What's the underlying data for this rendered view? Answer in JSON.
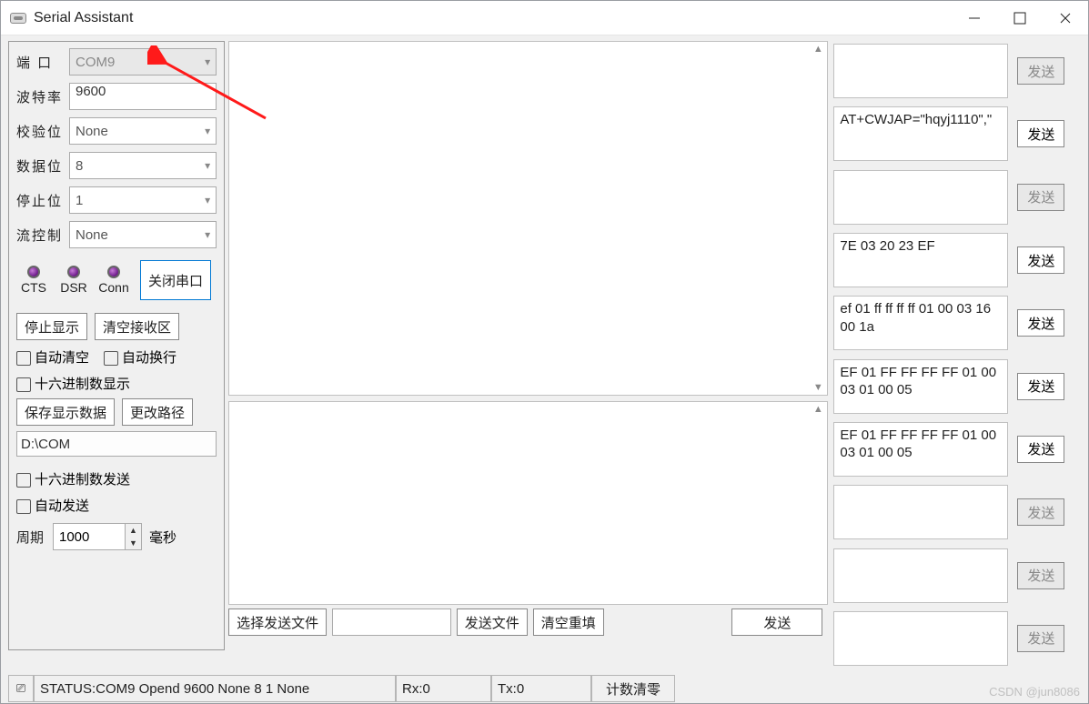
{
  "title": "Serial Assistant",
  "left": {
    "labels": {
      "port": "端 口",
      "baud": "波特率",
      "parity": "校验位",
      "databits": "数据位",
      "stopbits": "停止位",
      "flow": "流控制"
    },
    "values": {
      "port": "COM9",
      "baud": "9600",
      "parity": "None",
      "databits": "8",
      "stopbits": "1",
      "flow": "None"
    },
    "status_labels": {
      "cts": "CTS",
      "dsr": "DSR",
      "conn": "Conn"
    },
    "close_port_btn": "关闭串口",
    "stop_display_btn": "停止显示",
    "clear_rx_btn": "清空接收区",
    "auto_clear": "自动清空",
    "auto_wrap": "自动换行",
    "hex_disp": "十六进制数显示",
    "save_data_btn": "保存显示数据",
    "change_path_btn": "更改路径",
    "path": "D:\\COM",
    "hex_send": "十六进制数发送",
    "auto_send": "自动发送",
    "period_label": "周期",
    "period_value": "1000",
    "ms": "毫秒"
  },
  "bottom": {
    "choose_file": "选择发送文件",
    "send_file": "发送文件",
    "clear_refill": "清空重填",
    "send": "发送"
  },
  "status": {
    "text": "STATUS:COM9 Opend 9600 None 8 1 None",
    "rx": "Rx:0",
    "tx": "Tx:0",
    "clear_count": "计数清零"
  },
  "right_entries": [
    {
      "text": "",
      "disabled": true
    },
    {
      "text": "AT+CWJAP=\"hqyj1110\",\"",
      "disabled": false
    },
    {
      "text": "",
      "disabled": true
    },
    {
      "text": "7E 03 20 23 EF",
      "disabled": false
    },
    {
      "text": "ef 01 ff ff ff ff 01 00 03 16 00 1a",
      "disabled": false
    },
    {
      "text": "EF 01 FF FF FF FF 01 00 03 01 00 05",
      "disabled": false
    },
    {
      "text": "EF 01 FF FF FF FF 01 00 03 01 00 05",
      "disabled": false
    },
    {
      "text": "",
      "disabled": true
    },
    {
      "text": "",
      "disabled": true
    },
    {
      "text": "",
      "disabled": true
    }
  ],
  "send_label": "发送",
  "watermark": "CSDN @jun8086"
}
